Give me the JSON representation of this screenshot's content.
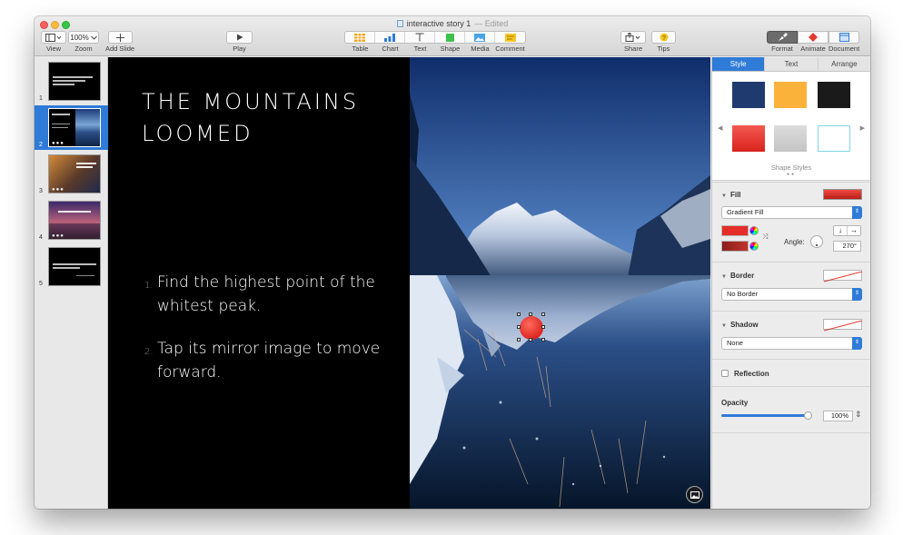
{
  "window": {
    "title": "interactive story 1",
    "status": "Edited"
  },
  "toolbar": {
    "view": "View",
    "zoom_value": "100%",
    "zoom": "Zoom",
    "add_slide": "Add Slide",
    "play": "Play",
    "table": "Table",
    "chart": "Chart",
    "text": "Text",
    "shape": "Shape",
    "media": "Media",
    "comment": "Comment",
    "share": "Share",
    "tips": "Tips",
    "format": "Format",
    "animate": "Animate",
    "document": "Document"
  },
  "navigator": {
    "slides": [
      "1",
      "2",
      "3",
      "4",
      "5"
    ],
    "selected": "2"
  },
  "slide": {
    "title": "THE MOUNTAINS\nLOOMED",
    "bullets": [
      {
        "num": "1.",
        "text": "Find the highest point of the whitest peak."
      },
      {
        "num": "2.",
        "text": "Tap its mirror image to move forward."
      }
    ]
  },
  "inspector": {
    "tabs": [
      "Style",
      "Text",
      "Arrange"
    ],
    "active_tab": "Style",
    "shape_styles_label": "Shape Styles",
    "swatches": [
      "#1f3a6e",
      "#fbb23b",
      "#1a1a1a",
      "#e83a34",
      "#cfcfcf",
      "#ffffff"
    ],
    "fill": {
      "label": "Fill",
      "type": "Gradient Fill",
      "angle_label": "Angle:",
      "angle": "270°",
      "color_a": "#e52d27",
      "color_b": "#8a1f1b"
    },
    "border": {
      "label": "Border",
      "value": "No Border"
    },
    "shadow": {
      "label": "Shadow",
      "value": "None"
    },
    "reflection": {
      "label": "Reflection",
      "checked": false
    },
    "opacity": {
      "label": "Opacity",
      "value": "100%",
      "fraction": 1.0
    }
  }
}
